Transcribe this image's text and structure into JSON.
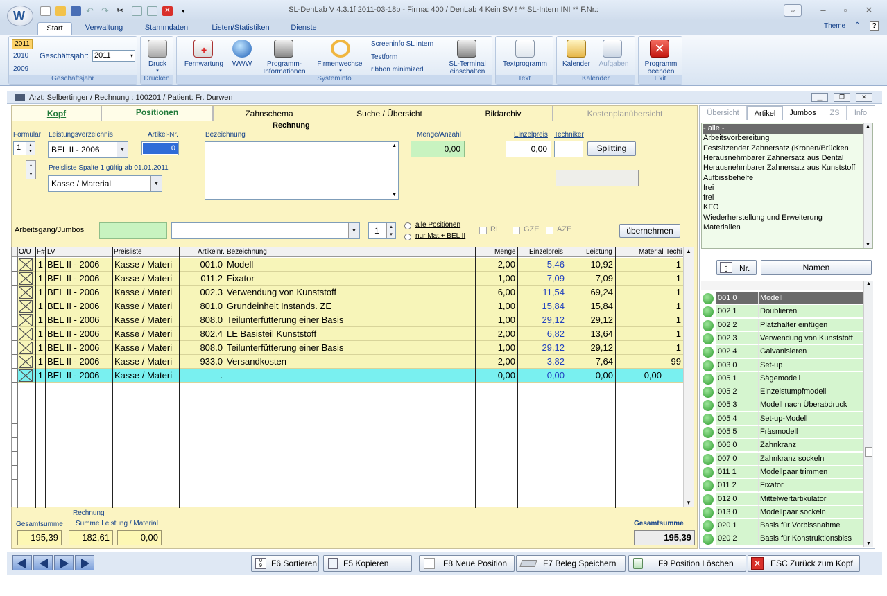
{
  "window": {
    "title": "SL-DenLab V 4.3.1f 2011-03-18b - Firma: 400 / DenLab 4 Kein SV ! ** SL-Intern INI **  F.Nr.:",
    "theme_label": "Theme"
  },
  "ribbon": {
    "tabs": [
      "Start",
      "Verwaltung",
      "Stammdaten",
      "Listen/Statistiken",
      "Dienste"
    ],
    "geschaeftsjahr": {
      "years": [
        "2011",
        "2010",
        "2009"
      ],
      "label": "Geschäftsjahr:",
      "value": "2011",
      "group_label": "Geschäftsjahr"
    },
    "druck": {
      "label": "Druck",
      "group_label": "Drucken"
    },
    "systeminfo": {
      "fernwartung": "Fernwartung",
      "www": "WWW",
      "programm_info_1": "Programm-",
      "programm_info_2": "Informationen",
      "firmenwechsel": "Firmenwechsel",
      "screeninfo": "Screeninfo SL intern",
      "testform": "Testform",
      "ribbon_minimized": "ribbon minimized",
      "terminal_1": "SL-Terminal",
      "terminal_2": "einschalten",
      "group_label": "Systeminfo"
    },
    "text": {
      "textprogramm": "Textprogramm",
      "group_label": "Text"
    },
    "kalender": {
      "kalender": "Kalender",
      "aufgaben": "Aufgaben",
      "group_label": "Kalender"
    },
    "exit": {
      "label_1": "Programm",
      "label_2": "beenden",
      "group_label": "Exit"
    }
  },
  "mdi": {
    "title": "Arzt: Selbertinger  / Rechnung : 100201 / Patient: Fr. Durwen"
  },
  "page_tabs": [
    "Kopf",
    "Positionen",
    "Zahnschema",
    "Suche / Übersicht",
    "Bildarchiv",
    "Kostenplanübersicht"
  ],
  "form": {
    "heading": "Rechnung",
    "formular_label": "Formular",
    "formular_value": "1",
    "lv_label": "Leistungsverzeichnis",
    "lv_value": "BEL II - 2006",
    "artikel_label": "Artikel-Nr.",
    "artikel_value": "0",
    "bezeichnung_label": "Bezeichnung",
    "menge_label": "Menge/Anzahl",
    "menge_value": "0,00",
    "einzelpreis_label": "Einzelpreis",
    "einzelpreis_value": "0,00",
    "techniker_label": "Techniker",
    "splitting_label": "Splitting",
    "preisliste_info": "Preisliste Spalte 1 gültig ab 01.01.2011",
    "preisliste_value": "Kasse / Material",
    "arbeitsgang_label": "Arbeitsgang/Jumbos",
    "jumbo_count": "1",
    "alle_positionen": "alle Positionen",
    "nur_mat": "nur Mat.+ BEL II",
    "rl": "RL",
    "gze": "GZE",
    "aze": "AZE",
    "uebernehmen": "übernehmen"
  },
  "grid": {
    "headers": [
      "O/U",
      "F#",
      "LV",
      "Preisliste",
      "Artikelnr.",
      "Bezeichnung",
      "Menge",
      "Einzelpreis",
      "Leistung",
      "Material",
      "Techi"
    ],
    "rows": [
      {
        "f": "1",
        "lv": "BEL II - 2006",
        "pl": "Kasse / Materi",
        "nr": "001.0",
        "bez": "Modell",
        "menge": "2,00",
        "ep": "5,46",
        "leistung": "10,92",
        "material": "",
        "tech": "1"
      },
      {
        "f": "1",
        "lv": "BEL II - 2006",
        "pl": "Kasse / Materi",
        "nr": "011.2",
        "bez": "Fixator",
        "menge": "1,00",
        "ep": "7,09",
        "leistung": "7,09",
        "material": "",
        "tech": "1"
      },
      {
        "f": "1",
        "lv": "BEL II - 2006",
        "pl": "Kasse / Materi",
        "nr": "002.3",
        "bez": "Verwendung von Kunststoff",
        "menge": "6,00",
        "ep": "11,54",
        "leistung": "69,24",
        "material": "",
        "tech": "1"
      },
      {
        "f": "1",
        "lv": "BEL II - 2006",
        "pl": "Kasse / Materi",
        "nr": "801.0",
        "bez": "Grundeinheit Instands. ZE",
        "menge": "1,00",
        "ep": "15,84",
        "leistung": "15,84",
        "material": "",
        "tech": "1"
      },
      {
        "f": "1",
        "lv": "BEL II - 2006",
        "pl": "Kasse / Materi",
        "nr": "808.0",
        "bez": "Teilunterfütterung einer Basis",
        "menge": "1,00",
        "ep": "29,12",
        "leistung": "29,12",
        "material": "",
        "tech": "1"
      },
      {
        "f": "1",
        "lv": "BEL II - 2006",
        "pl": "Kasse / Materi",
        "nr": "802.4",
        "bez": "LE Basisteil Kunststoff",
        "menge": "2,00",
        "ep": "6,82",
        "leistung": "13,64",
        "material": "",
        "tech": "1"
      },
      {
        "f": "1",
        "lv": "BEL II - 2006",
        "pl": "Kasse / Materi",
        "nr": "808.0",
        "bez": "Teilunterfütterung einer Basis",
        "menge": "1,00",
        "ep": "29,12",
        "leistung": "29,12",
        "material": "",
        "tech": "1"
      },
      {
        "f": "1",
        "lv": "BEL II - 2006",
        "pl": "Kasse / Materi",
        "nr": "933.0",
        "bez": "Versandkosten",
        "menge": "2,00",
        "ep": "3,82",
        "leistung": "7,64",
        "material": "",
        "tech": "99"
      },
      {
        "f": "1",
        "lv": "BEL II - 2006",
        "pl": "Kasse / Materi",
        "nr": ".",
        "bez": "",
        "menge": "0,00",
        "ep": "0,00",
        "leistung": "0,00",
        "material": "0,00",
        "tech": ""
      }
    ]
  },
  "summary": {
    "rechnung_label": "Rechnung",
    "gesamtsumme_label": "Gesamtsumme",
    "summe_label": "Summe Leistung / Material",
    "gesamtsumme": "195,39",
    "leistung": "182,61",
    "material": "0,00",
    "gesamtsumme_right_label": "Gesamtsumme",
    "gesamtsumme_right": "195,39"
  },
  "bottom_buttons": {
    "sortieren": "F6 Sortieren",
    "kopieren": "F5 Kopieren",
    "neue_position": "F8 Neue Position",
    "beleg_speichern": "F7 Beleg Speichern",
    "position_loeschen": "F9 Position Löschen",
    "zurueck": "ESC Zurück zum Kopf"
  },
  "right_pane": {
    "tabs": [
      "Übersicht",
      "Artikel",
      "Jumbos",
      "ZS",
      "Info"
    ],
    "categories": [
      "- alle -",
      "Arbeitsvorbereitung",
      "Festsitzender Zahnersatz (Kronen/Brücken",
      "Herausnehmbarer Zahnersatz aus Dental",
      "Herausnehmbarer Zahnersatz aus Kunststoff",
      "Aufbissbehelfe",
      "frei",
      "frei",
      "KFO",
      "Wiederherstellung und Erweiterung",
      "Materialien"
    ],
    "sort_nr": "Nr.",
    "sort_namen": "Namen",
    "articles": [
      {
        "nr": "001 0",
        "name": "Modell"
      },
      {
        "nr": "002 1",
        "name": "Doublieren"
      },
      {
        "nr": "002 2",
        "name": "Platzhalter einfügen"
      },
      {
        "nr": "002 3",
        "name": "Verwendung von Kunststoff"
      },
      {
        "nr": "002 4",
        "name": "Galvanisieren"
      },
      {
        "nr": "003 0",
        "name": "Set-up"
      },
      {
        "nr": "005 1",
        "name": "Sägemodell"
      },
      {
        "nr": "005 2",
        "name": "Einzelstumpfmodell"
      },
      {
        "nr": "005 3",
        "name": "Modell nach Überabdruck"
      },
      {
        "nr": "005 4",
        "name": "Set-up-Modell"
      },
      {
        "nr": "005 5",
        "name": "Fräsmodell"
      },
      {
        "nr": "006 0",
        "name": "Zahnkranz"
      },
      {
        "nr": "007 0",
        "name": "Zahnkranz sockeln"
      },
      {
        "nr": "011 1",
        "name": "Modellpaar trimmen"
      },
      {
        "nr": "011 2",
        "name": "Fixator"
      },
      {
        "nr": "012 0",
        "name": "Mittelwertartikulator"
      },
      {
        "nr": "013 0",
        "name": "Modellpaar sockeln"
      },
      {
        "nr": "020 1",
        "name": "Basis für Vorbissnahme"
      },
      {
        "nr": "020 2",
        "name": "Basis für Konstruktionsbiss"
      }
    ]
  },
  "colors": {
    "yellow_panel": "#fbf4c2",
    "grid_yellow": "#f7f5b9",
    "selected_row": "#79f0f0",
    "green_field": "#d5f5cf",
    "link_blue": "#15428b"
  }
}
